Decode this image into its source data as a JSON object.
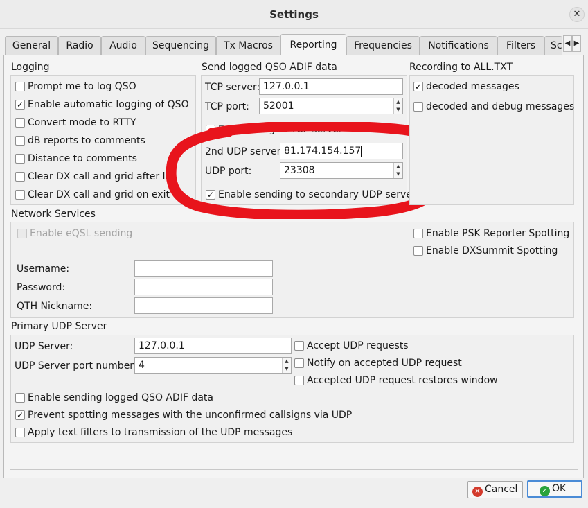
{
  "window": {
    "title": "Settings",
    "close_glyph": "✕"
  },
  "tabs": [
    {
      "label": "General"
    },
    {
      "label": "Radio"
    },
    {
      "label": "Audio"
    },
    {
      "label": "Sequencing"
    },
    {
      "label": "Tx Macros"
    },
    {
      "label": "Reporting"
    },
    {
      "label": "Frequencies"
    },
    {
      "label": "Notifications"
    },
    {
      "label": "Filters"
    },
    {
      "label": "Sc"
    }
  ],
  "active_tab": "Reporting",
  "logging": {
    "title": "Logging",
    "items": [
      {
        "label": "Prompt me to log QSO",
        "checked": false
      },
      {
        "label": "Enable automatic logging of QSO",
        "checked": true
      },
      {
        "label": "Convert mode to RTTY",
        "checked": false
      },
      {
        "label": "dB reports to comments",
        "checked": false
      },
      {
        "label": "Distance to comments",
        "checked": false
      },
      {
        "label": "Clear DX call and grid after lo",
        "checked": false
      },
      {
        "label": "Clear DX call and grid on exit",
        "checked": false
      }
    ]
  },
  "adif": {
    "title": "Send logged QSO ADIF data",
    "tcp_server_label": "TCP server:",
    "tcp_server_value": "127.0.0.1",
    "tcp_port_label": "TCP port:",
    "tcp_port_value": "52001",
    "tcp_enable_label": "E... sending to TCP server",
    "udp2_server_label": "2nd UDP server",
    "udp2_server_value": "81.174.154.157",
    "udp_port_label": "UDP port:",
    "udp_port_value": "23308",
    "udp2_enable_label": "Enable sending to secondary UDP serve",
    "udp2_enable_checked": true
  },
  "recording": {
    "title": "Recording to ALL.TXT",
    "items": [
      {
        "label": "decoded messages",
        "checked": true
      },
      {
        "label": "decoded and debug messages",
        "checked": false
      }
    ]
  },
  "network": {
    "title": "Network Services",
    "eqsl_label": "Enable eQSL sending",
    "psk_label": "Enable PSK Reporter Spotting",
    "dxsummit_label": "Enable DXSummit Spotting",
    "username_label": "Username:",
    "password_label": "Password:",
    "qth_label": "QTH Nickname:",
    "username_value": "",
    "password_value": "",
    "qth_value": ""
  },
  "primary_udp": {
    "title": "Primary UDP Server",
    "server_label": "UDP Server:",
    "server_value": "127.0.0.1",
    "port_label": "UDP Server port number:",
    "port_value": "4",
    "accept_label": "Accept UDP requests",
    "notify_label": "Notify on accepted UDP request",
    "restore_label": "Accepted UDP request restores window",
    "enable_adif_label": "Enable sending logged QSO ADIF data",
    "enable_adif_checked": false,
    "prevent_label": "Prevent spotting messages with the unconfirmed callsigns via UDP",
    "prevent_checked": true,
    "apply_filters_label": "Apply text filters to transmission of the UDP messages",
    "apply_filters_checked": false
  },
  "buttons": {
    "cancel_label": "Cancel",
    "ok_label": "OK"
  },
  "colors": {
    "annotation_red": "#e8141c",
    "ok_border": "#4a8bd6",
    "cancel_icon": "#d33a2c",
    "ok_icon": "#2aa33c"
  },
  "icons": {
    "cancel": "x-circle-icon",
    "ok": "check-circle-icon"
  }
}
